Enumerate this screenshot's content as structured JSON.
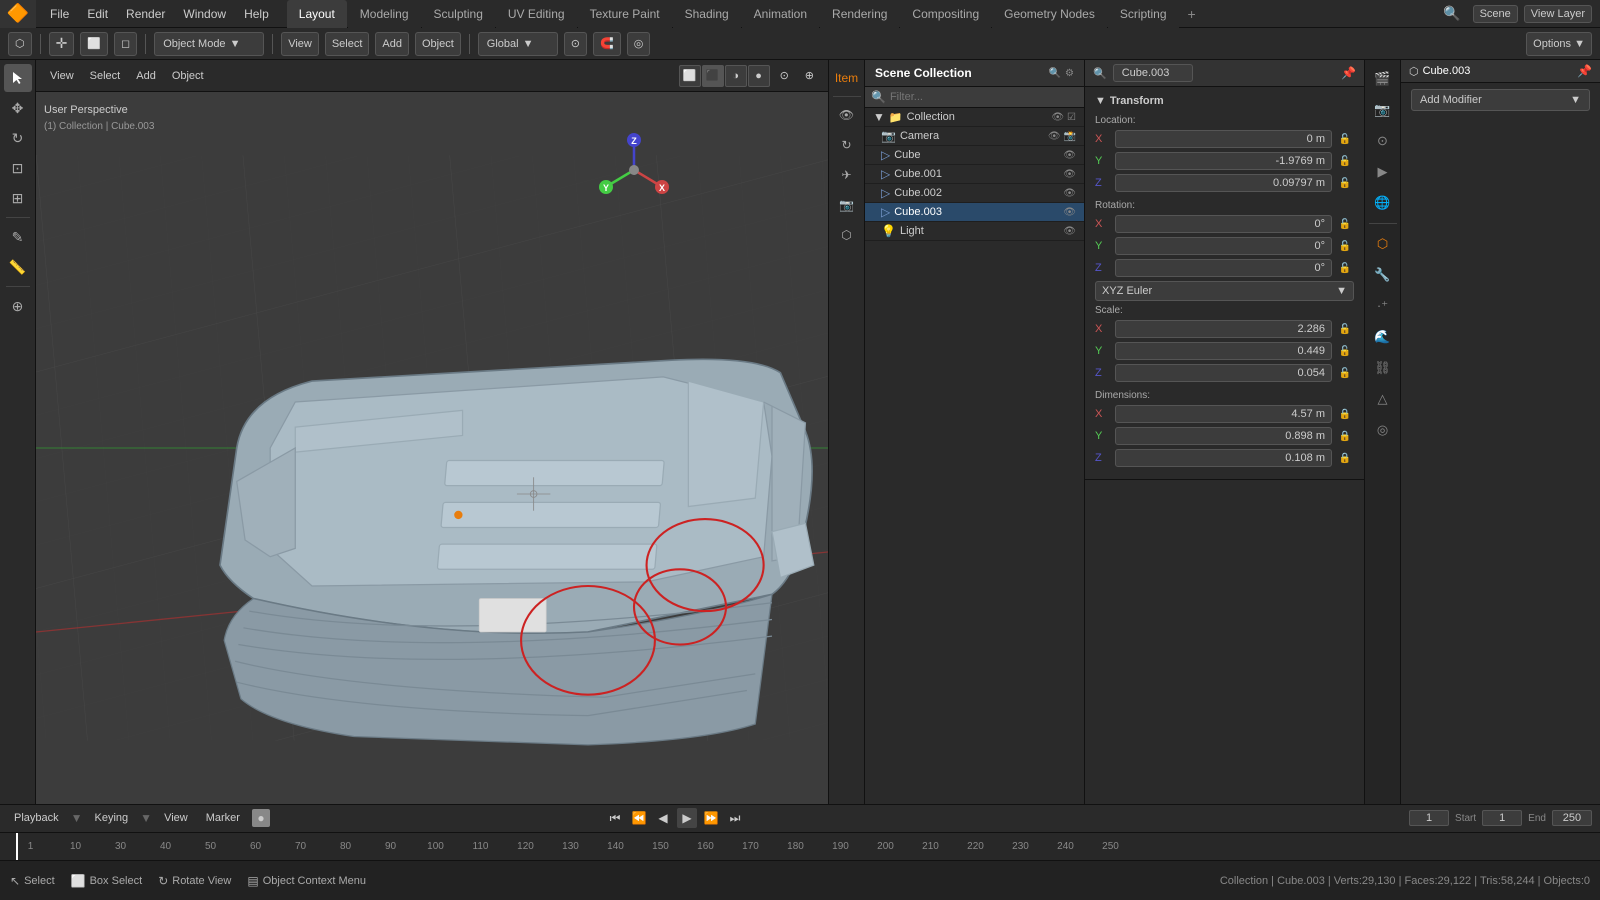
{
  "app": {
    "title": "Blender",
    "logo": "🔶"
  },
  "topmenu": {
    "items": [
      "File",
      "Edit",
      "Render",
      "Window",
      "Help"
    ]
  },
  "workspace_tabs": [
    {
      "label": "Layout",
      "active": true
    },
    {
      "label": "Modeling",
      "active": false
    },
    {
      "label": "Sculpting",
      "active": false
    },
    {
      "label": "UV Editing",
      "active": false
    },
    {
      "label": "Texture Paint",
      "active": false
    },
    {
      "label": "Shading",
      "active": false
    },
    {
      "label": "Animation",
      "active": false
    },
    {
      "label": "Rendering",
      "active": false
    },
    {
      "label": "Compositing",
      "active": false
    },
    {
      "label": "Geometry Nodes",
      "active": false
    },
    {
      "label": "Scripting",
      "active": false
    }
  ],
  "header": {
    "scene_label": "Scene",
    "view_layer_label": "View Layer"
  },
  "second_toolbar": {
    "mode": "Object Mode",
    "view_btn": "View",
    "select_btn": "Select",
    "add_btn": "Add",
    "object_btn": "Object",
    "transform_global": "Global"
  },
  "viewport": {
    "label": "User Perspective",
    "sublabel": "(1) Collection | Cube.003"
  },
  "left_tools": [
    {
      "icon": "↖",
      "name": "select-tool",
      "active": true
    },
    {
      "icon": "✥",
      "name": "move-tool",
      "active": false
    },
    {
      "icon": "↻",
      "name": "rotate-tool",
      "active": false
    },
    {
      "icon": "⊡",
      "name": "scale-tool",
      "active": false
    },
    {
      "icon": "⊞",
      "name": "transform-tool",
      "active": false
    },
    {
      "separator": true
    },
    {
      "icon": "✎",
      "name": "annotate-tool",
      "active": false
    },
    {
      "icon": "📏",
      "name": "measure-tool",
      "active": false
    },
    {
      "separator": true
    },
    {
      "icon": "⊕",
      "name": "add-tool",
      "active": false
    }
  ],
  "transform_panel": {
    "title": "Transform",
    "location_label": "Location:",
    "location": {
      "x": "0 m",
      "y": "-1.9769 m",
      "z": "0.09797 m"
    },
    "rotation_label": "Rotation:",
    "rotation": {
      "x": "0°",
      "y": "0°",
      "z": "0°"
    },
    "rotation_mode": "XYZ Euler",
    "scale_label": "Scale:",
    "scale": {
      "x": "2.286",
      "y": "0.449",
      "z": "0.054"
    },
    "dimensions_label": "Dimensions:",
    "dimensions": {
      "x": "4.57 m",
      "y": "0.898 m",
      "z": "0.108 m"
    }
  },
  "outliner": {
    "title": "Scene Collection",
    "items": [
      {
        "name": "Collection",
        "indent": 0,
        "icon": "📁",
        "expanded": true
      },
      {
        "name": "Camera",
        "indent": 1,
        "icon": "📷"
      },
      {
        "name": "Cube",
        "indent": 1,
        "icon": "⬜"
      },
      {
        "name": "Cube.001",
        "indent": 1,
        "icon": "⬜",
        "active": false
      },
      {
        "name": "Cube.002",
        "indent": 1,
        "icon": "⬜",
        "active": false
      },
      {
        "name": "Cube.003",
        "indent": 1,
        "icon": "⬜",
        "active": true
      },
      {
        "name": "Light",
        "indent": 1,
        "icon": "💡"
      }
    ]
  },
  "properties": {
    "selected_object": "Cube.003",
    "add_modifier_label": "Add Modifier",
    "tabs": [
      "🎬",
      "📷",
      "⊙",
      "▶",
      "⚙",
      "🔧",
      "👤",
      "🟠",
      "🌊",
      "⚡",
      "📷",
      "🎨",
      "⬜"
    ]
  },
  "timeline": {
    "playback_label": "Playback",
    "keying_label": "Keying",
    "view_label": "View",
    "marker_label": "Marker",
    "frame_current": "1",
    "start": "1",
    "end": "250",
    "start_label": "Start",
    "end_label": "End",
    "numbers": [
      "1",
      "10",
      "30",
      "40",
      "50",
      "60",
      "70",
      "80",
      "90",
      "100",
      "110",
      "120",
      "130",
      "140",
      "150",
      "160",
      "170",
      "180",
      "190",
      "200",
      "210",
      "220",
      "230",
      "240",
      "250"
    ]
  },
  "status_bar": {
    "select_label": "Select",
    "box_select_label": "Box Select",
    "rotate_view_label": "Rotate View",
    "context_menu_label": "Object Context Menu",
    "info": "Collection | Cube.003 | Verts:29,130 | Faces:29,122 | Tris:58,244 | Objects:0"
  }
}
